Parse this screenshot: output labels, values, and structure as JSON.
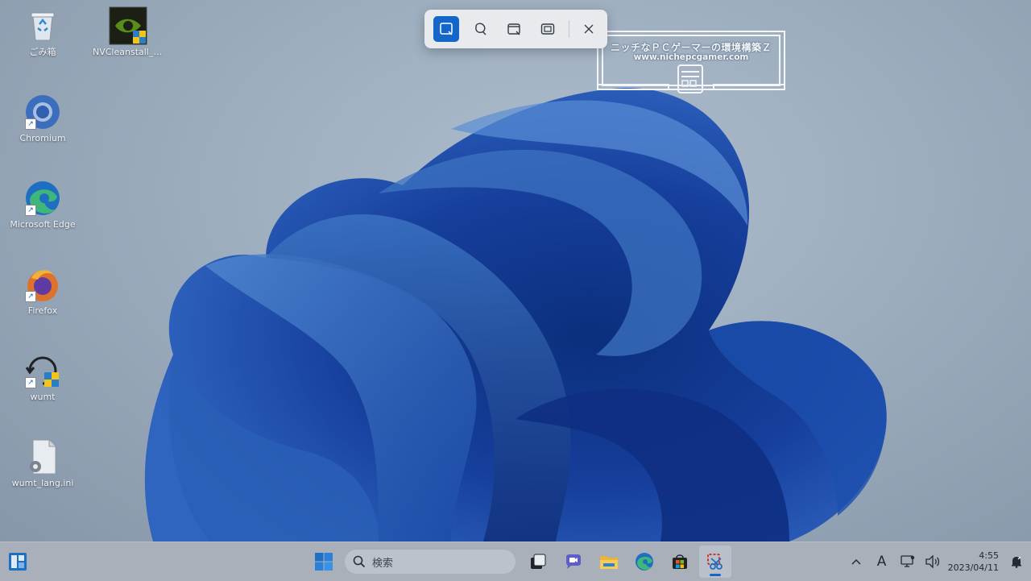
{
  "desktop": {
    "icons": [
      {
        "label": "ごみ箱",
        "icon": "recycle-bin-icon"
      },
      {
        "label": "NVCleanstall_NVI...",
        "icon": "nvcleanstall-icon"
      },
      {
        "label": "Chromium",
        "icon": "chromium-icon"
      },
      {
        "label": "Microsoft Edge",
        "icon": "edge-icon"
      },
      {
        "label": "Firefox",
        "icon": "firefox-icon"
      },
      {
        "label": "wumt",
        "icon": "wumt-icon"
      },
      {
        "label": "wumt_lang.ini",
        "icon": "ini-file-icon"
      }
    ]
  },
  "snipping_toolbar": {
    "modes": [
      "rectangle-snip",
      "freeform-snip",
      "window-snip",
      "fullscreen-snip"
    ],
    "active_mode": "rectangle-snip",
    "accent": "#1467c9"
  },
  "watermark": {
    "title": "ニッチなＰＣゲーマーの環境構築Ｚ",
    "url": "www.nichepcgamer.com"
  },
  "taskbar": {
    "search_placeholder": "検索",
    "apps": [
      "start-icon",
      "task-view-icon",
      "teams-chat-icon",
      "file-explorer-icon",
      "edge-icon",
      "store-icon",
      "snipping-tool-icon"
    ],
    "active_app": "snipping-tool-icon",
    "tray": {
      "ime_indicator": "A",
      "time": "4:55",
      "date": "2023/04/11"
    }
  }
}
